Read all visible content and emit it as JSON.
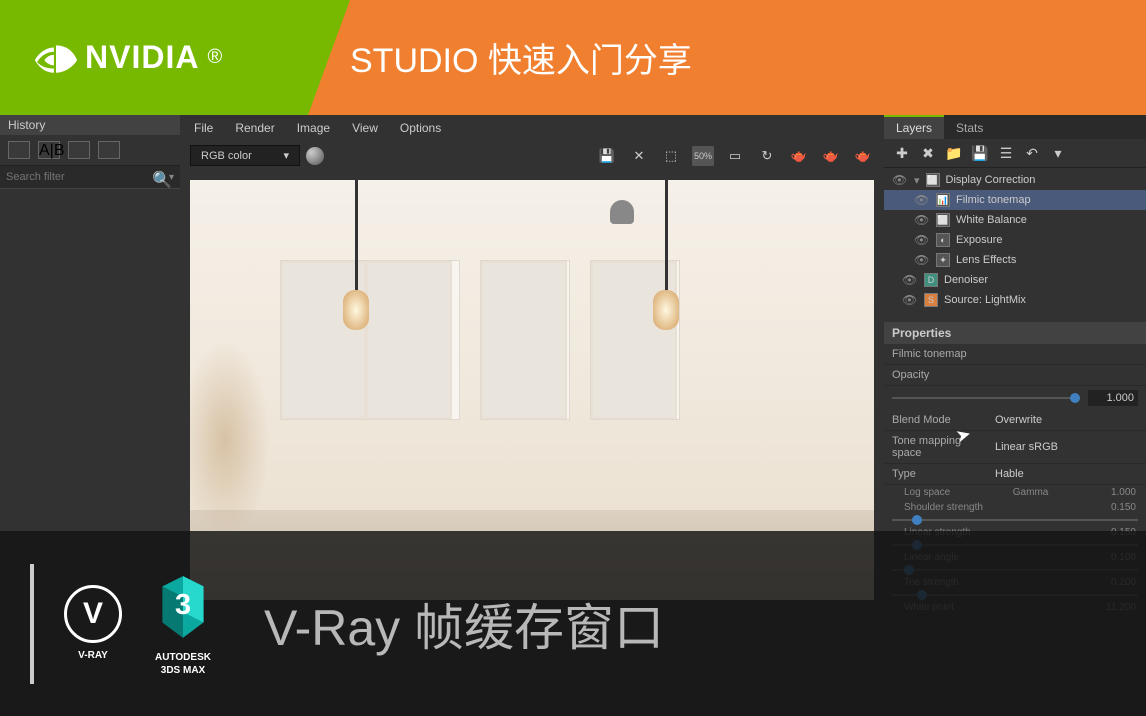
{
  "banner": {
    "nvidia": "NVIDIA",
    "title": "STUDIO 快速入门分享"
  },
  "history": {
    "title": "History",
    "search_placeholder": "Search filter"
  },
  "menu": {
    "file": "File",
    "render": "Render",
    "image": "Image",
    "view": "View",
    "options": "Options"
  },
  "toolbar": {
    "color_mode": "RGB color",
    "zoom": "50%"
  },
  "right": {
    "tabs": {
      "layers": "Layers",
      "stats": "Stats"
    },
    "layers": {
      "display_correction": "Display Correction",
      "filmic": "Filmic tonemap",
      "white_balance": "White Balance",
      "exposure": "Exposure",
      "lens_effects": "Lens Effects",
      "denoiser": "Denoiser",
      "source": "Source: LightMix"
    },
    "properties": {
      "header": "Properties",
      "name": "Filmic tonemap",
      "opacity_label": "Opacity",
      "opacity_val": "1.000",
      "blend_mode_label": "Blend Mode",
      "blend_mode_val": "Overwrite",
      "tone_space_label": "Tone mapping space",
      "tone_space_val": "Linear sRGB",
      "type_label": "Type",
      "type_val": "Hable",
      "log_space": "Log space",
      "gamma": "Gamma",
      "gamma_val": "1.000",
      "shoulder": "Shoulder strength",
      "shoulder_val": "0.150",
      "linear_str": "Linear strength",
      "linear_str_val": "0.150",
      "linear_angle": "Linear angle",
      "linear_angle_val": "0.100",
      "toe": "Toe strength",
      "toe_val": "0.200",
      "white_point": "White point",
      "white_point_val": "11.200"
    }
  },
  "overlay": {
    "vray": "V-RAY",
    "autodesk": "AUTODESK",
    "max": "3DS MAX",
    "title": "V-Ray 帧缓存窗口"
  }
}
